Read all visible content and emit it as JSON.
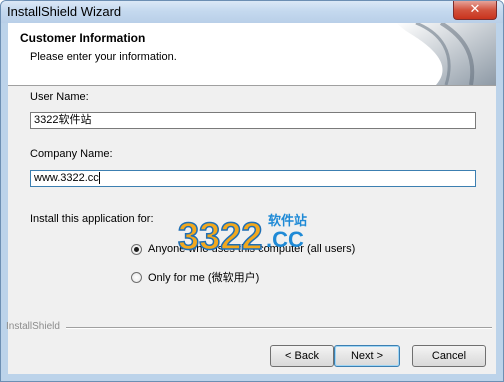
{
  "window": {
    "title": "InstallShield Wizard",
    "close_glyph": "✕"
  },
  "header": {
    "title": "Customer Information",
    "subtitle": "Please enter your information."
  },
  "form": {
    "user_name_label": "User Name:",
    "user_name_value": "3322软件站",
    "company_name_label": "Company Name:",
    "company_name_value": "www.3322.cc",
    "install_for_label": "Install this application for:",
    "options": [
      {
        "label": "Anyone who uses this computer (all users)",
        "selected": true
      },
      {
        "label": "Only for me (微软用户)",
        "selected": false
      }
    ]
  },
  "watermark": {
    "text_main": "3322",
    "text_suffix": ".CC",
    "text_cn": "软件站"
  },
  "footer": {
    "brand": "InstallShield",
    "back_label": "< Back",
    "next_label": "Next >",
    "cancel_label": "Cancel"
  }
}
